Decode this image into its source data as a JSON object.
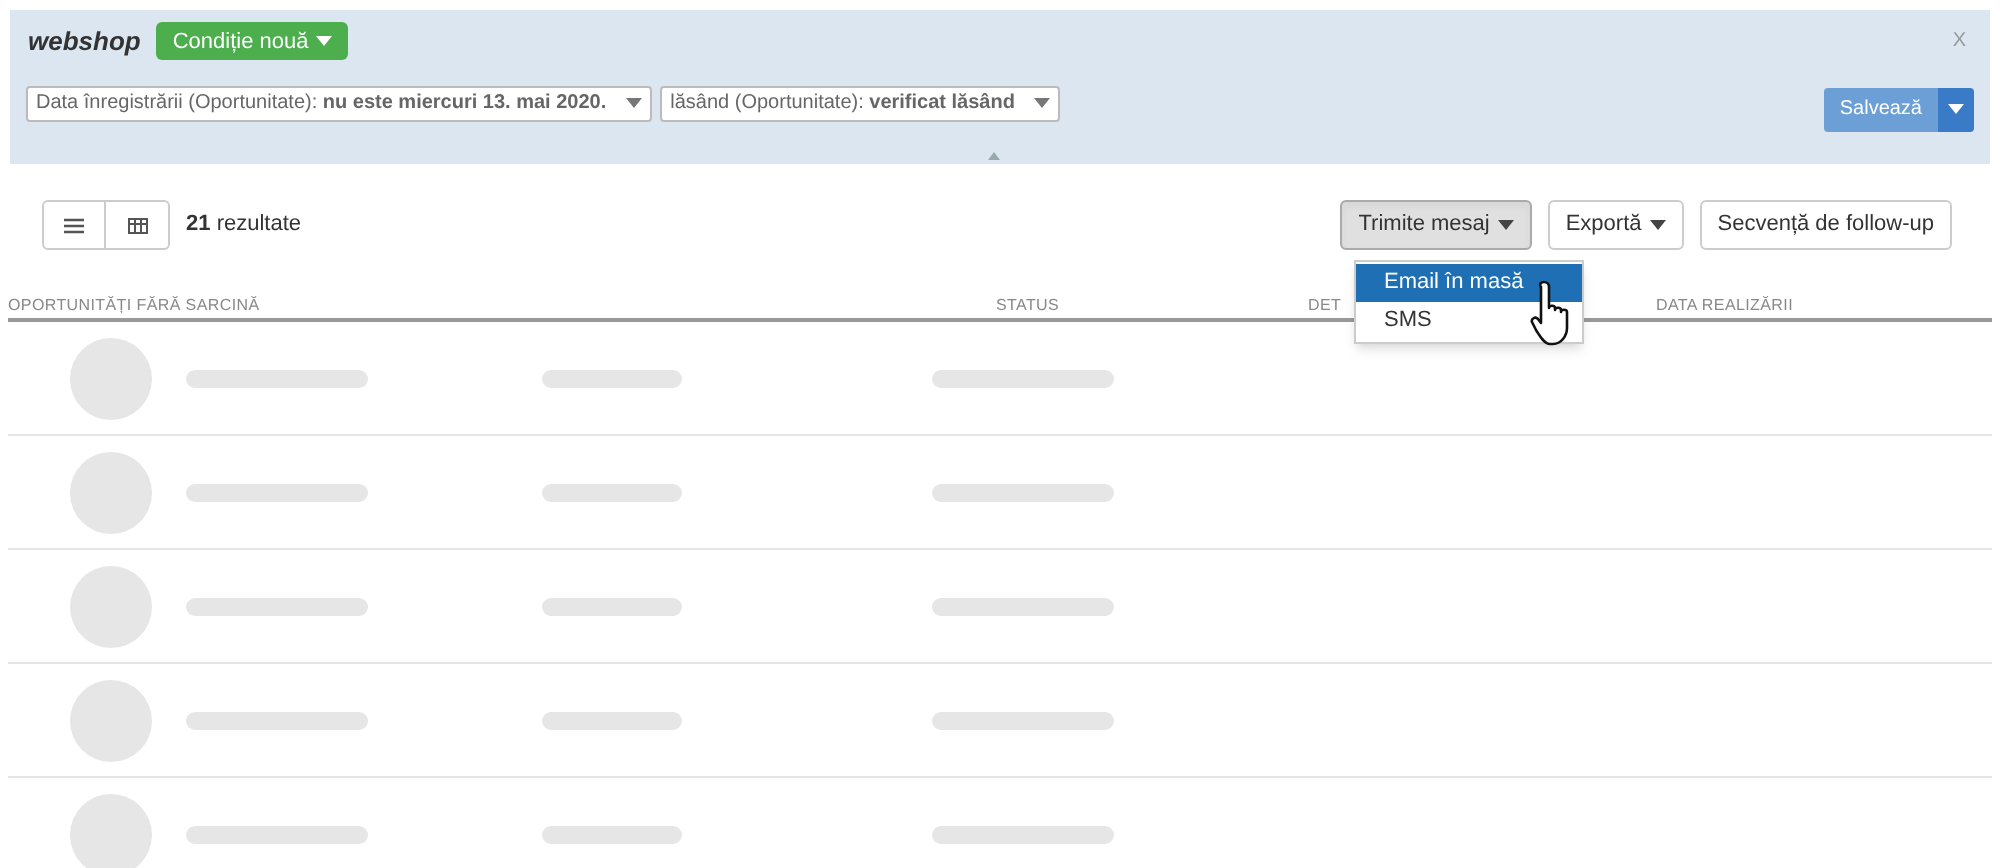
{
  "filter_panel": {
    "title": "webshop",
    "new_condition_button": "Condiție nouă",
    "filters": [
      {
        "text": "Data înregistrării (Oportunitate): **nu este miercuri 13. mai 2020.**"
      },
      {
        "text": "lăsând (Oportunitate): **verificat lăsând**"
      }
    ],
    "close_label": "X",
    "save_button": "Salvează"
  },
  "toolbar": {
    "result_count": "21",
    "result_label": "rezultate",
    "buttons": [
      {
        "label": "Trimite mesaj",
        "kind": "dropdown",
        "open": true,
        "menu": [
          {
            "label": "Email în masă",
            "selected": true
          },
          {
            "label": "SMS",
            "selected": false
          }
        ]
      },
      {
        "label": "Exportă",
        "kind": "dropdown",
        "open": false
      },
      {
        "label": "Secvență de follow-up",
        "kind": "plain",
        "open": false
      }
    ]
  },
  "table": {
    "columns": [
      "OPORTUNITĂȚI FĂRĂ SARCINĂ",
      "STATUS",
      "DET",
      "DATA REALIZĂRII"
    ]
  }
}
